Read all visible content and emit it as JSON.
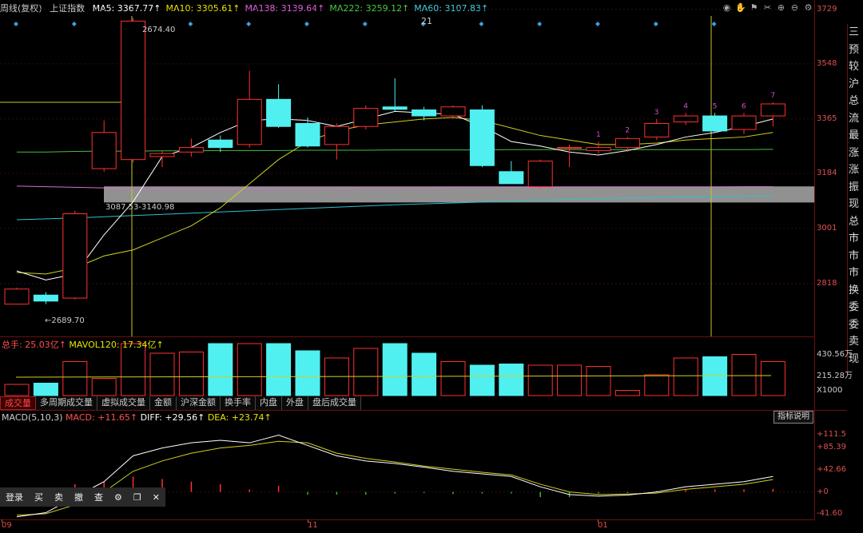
{
  "header": {
    "title": "周线(复权)",
    "index": "上证指数",
    "ma": [
      {
        "label": "MA5: 3367.77↑",
        "color": "#ffffff"
      },
      {
        "label": "MA10: 3305.61↑",
        "color": "#e6e600"
      },
      {
        "label": "MA138: 3139.64↑",
        "color": "#e060e0"
      },
      {
        "label": "MA222: 3259.12↑",
        "color": "#40d040"
      },
      {
        "label": "MA60: 3107.83↑",
        "color": "#40d0e0"
      }
    ]
  },
  "annotations": {
    "top_number": "21",
    "high_label": "2674.40",
    "low_label": "←2689.70",
    "zone_label": "3087.53-3140.98",
    "seq": [
      "1",
      "2",
      "3",
      "4",
      "5",
      "6",
      "7"
    ]
  },
  "volume": {
    "label": "总手: 25.03亿↑",
    "mavol": "MAVOL120: 17.34亿↑",
    "axis": [
      "430.56万",
      "215.28万",
      "X1000"
    ]
  },
  "tabs": [
    "成交量",
    "多周期成交量",
    "虚拟成交量",
    "金额",
    "沪深金额",
    "换手率",
    "内盘",
    "外盘",
    "盘后成交量"
  ],
  "macd": {
    "label": "MACD(5,10,3)",
    "macd": "MACD: +11.65↑",
    "diff": "DIFF: +29.56↑",
    "dea": "DEA: +23.74↑",
    "axis": [
      "+111.5",
      "+85.39",
      "+42.66",
      "+0",
      "-41.60"
    ],
    "button": "指标说明"
  },
  "trade_bar": [
    "登录",
    "买",
    "卖",
    "撤",
    "查",
    "⚙",
    "❐",
    "✕"
  ],
  "x_axis": [
    "09",
    "11",
    "01"
  ],
  "right_panel": [
    "三",
    "预",
    "较",
    "沪",
    "总",
    "流",
    "最",
    "涨",
    "涨",
    "振",
    "现",
    "总",
    "市",
    "市",
    "市",
    "换",
    "委",
    "委",
    "卖",
    "现"
  ],
  "chart_data": {
    "type": "candlestick",
    "price_axis": [
      3729,
      3548,
      3365,
      3184,
      3001,
      2818
    ],
    "ylim": [
      2640,
      3760
    ],
    "candles": [
      {
        "o": 2750,
        "c": 2800,
        "h": 2805,
        "l": 2748
      },
      {
        "o": 2780,
        "c": 2760,
        "h": 2790,
        "l": 2750
      },
      {
        "o": 2770,
        "c": 3050,
        "h": 3060,
        "l": 2765
      },
      {
        "o": 3200,
        "c": 3320,
        "h": 3360,
        "l": 3190
      },
      {
        "o": 3230,
        "c": 3690,
        "h": 3700,
        "l": 3220
      },
      {
        "o": 3240,
        "c": 3250,
        "h": 3260,
        "l": 3205
      },
      {
        "o": 3255,
        "c": 3270,
        "h": 3300,
        "l": 3240
      },
      {
        "o": 3295,
        "c": 3270,
        "h": 3310,
        "l": 3255
      },
      {
        "o": 3280,
        "c": 3430,
        "h": 3525,
        "l": 3270
      },
      {
        "o": 3430,
        "c": 3340,
        "h": 3480,
        "l": 3335
      },
      {
        "o": 3350,
        "c": 3275,
        "h": 3370,
        "l": 3270
      },
      {
        "o": 3280,
        "c": 3340,
        "h": 3350,
        "l": 3230
      },
      {
        "o": 3340,
        "c": 3400,
        "h": 3410,
        "l": 3330
      },
      {
        "o": 3405,
        "c": 3397,
        "h": 3500,
        "l": 3390
      },
      {
        "o": 3395,
        "c": 3375,
        "h": 3405,
        "l": 3360
      },
      {
        "o": 3375,
        "c": 3405,
        "h": 3410,
        "l": 3365
      },
      {
        "o": 3395,
        "c": 3210,
        "h": 3410,
        "l": 3205
      },
      {
        "o": 3190,
        "c": 3150,
        "h": 3225,
        "l": 3150
      },
      {
        "o": 3140,
        "c": 3225,
        "h": 3230,
        "l": 3135
      },
      {
        "o": 3270,
        "c": 3270,
        "h": 3280,
        "l": 3205
      },
      {
        "o": 3260,
        "c": 3270,
        "h": 3290,
        "l": 3250
      },
      {
        "o": 3270,
        "c": 3300,
        "h": 3305,
        "l": 3255
      },
      {
        "o": 3305,
        "c": 3350,
        "h": 3365,
        "l": 3295
      },
      {
        "o": 3355,
        "c": 3375,
        "h": 3385,
        "l": 3345
      },
      {
        "o": 3375,
        "c": 3325,
        "h": 3385,
        "l": 3320
      },
      {
        "o": 3330,
        "c": 3375,
        "h": 3385,
        "l": 3315
      },
      {
        "o": 3375,
        "c": 3415,
        "h": 3420,
        "l": 3340
      }
    ],
    "ma5": [
      2860,
      2830,
      2850,
      2980,
      3090,
      3240,
      3270,
      3320,
      3360,
      3365,
      3360,
      3340,
      3365,
      3390,
      3385,
      3380,
      3340,
      3290,
      3275,
      3255,
      3245,
      3260,
      3280,
      3305,
      3320,
      3340,
      3365
    ],
    "ma10": [
      2855,
      2850,
      2870,
      2910,
      2930,
      2970,
      3010,
      3070,
      3150,
      3230,
      3290,
      3325,
      3345,
      3355,
      3365,
      3370,
      3360,
      3335,
      3310,
      3295,
      3280,
      3280,
      3285,
      3295,
      3300,
      3305,
      3320
    ],
    "ma222": [
      3255,
      3255,
      3257,
      3258,
      3258,
      3259,
      3259,
      3260,
      3260,
      3260,
      3261,
      3261,
      3261,
      3262,
      3262,
      3262,
      3262,
      3263,
      3263,
      3263,
      3263,
      3263,
      3263,
      3263,
      3263,
      3263,
      3264
    ],
    "ma138": [
      3142,
      3140,
      3138,
      3136,
      3135,
      3134,
      3134,
      3134,
      3134,
      3135,
      3135,
      3135,
      3136,
      3136,
      3136,
      3137,
      3137,
      3137,
      3138,
      3138,
      3138,
      3139,
      3139,
      3139,
      3139,
      3140,
      3140
    ],
    "ma60": [
      3030,
      3033,
      3036,
      3040,
      3044,
      3048,
      3052,
      3056,
      3060,
      3064,
      3068,
      3072,
      3076,
      3080,
      3083,
      3086,
      3089,
      3092,
      3095,
      3098,
      3100,
      3102,
      3104,
      3106,
      3107,
      3108,
      3110
    ],
    "zone": [
      3087.53,
      3140.98
    ],
    "vol_ylim": [
      0,
      4.4
    ],
    "volume": [
      1.0,
      1.1,
      2.9,
      1.5,
      4.6,
      3.6,
      3.7,
      4.6,
      5.3,
      4.5,
      3.8,
      3.2,
      4.0,
      4.5,
      3.6,
      2.9,
      2.6,
      2.7,
      2.6,
      2.6,
      2.5,
      0.5,
      1.8,
      3.2,
      3.3,
      3.5,
      2.9
    ],
    "vol_ma": 1.6,
    "macd_ylim": [
      -50,
      120
    ],
    "diff": [
      -48,
      -40,
      -10,
      20,
      70,
      85,
      95,
      100,
      95,
      110,
      90,
      70,
      60,
      55,
      48,
      40,
      35,
      30,
      10,
      -5,
      -8,
      -6,
      0,
      10,
      15,
      20,
      30
    ],
    "dea": [
      -45,
      -42,
      -25,
      0,
      40,
      60,
      75,
      85,
      90,
      98,
      95,
      75,
      65,
      58,
      50,
      44,
      38,
      33,
      15,
      0,
      -5,
      -4,
      -2,
      5,
      10,
      15,
      24
    ],
    "macd_bars": [
      -3,
      2,
      15,
      20,
      30,
      25,
      20,
      15,
      5,
      12,
      -5,
      -5,
      -5,
      -3,
      -2,
      -4,
      -3,
      -3,
      -10,
      -10,
      -3,
      -2,
      2,
      5,
      5,
      5,
      6
    ]
  }
}
